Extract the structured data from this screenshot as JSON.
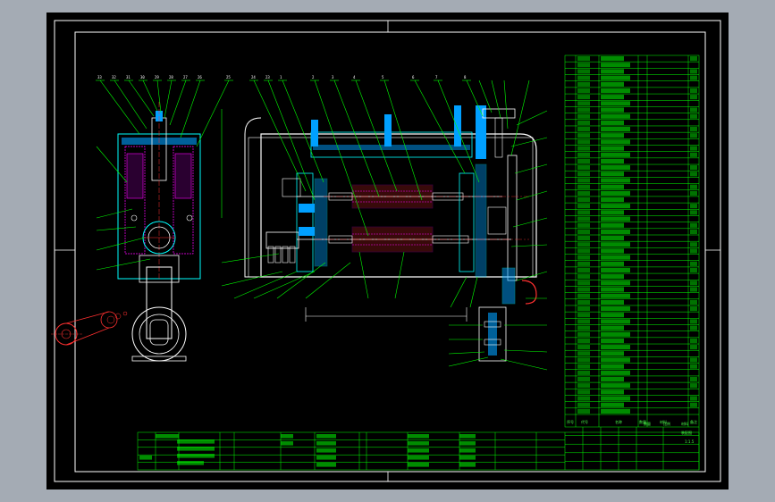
{
  "title_block": {
    "drawing_name": "装配图",
    "scale_label": "比例",
    "scale_value": "1:1.5",
    "quantity_label": "数量",
    "material_label": "材料",
    "bom_headers": [
      "序号",
      "代号",
      "名称",
      "数量",
      "材料",
      "备注"
    ]
  },
  "colors": {
    "sheet": "#000000",
    "frame": "#ffffff",
    "leader": "#00ff00",
    "part_outline": "#00ffff",
    "hidden_line": "#ff00ff",
    "section_fill": "#00a0ff",
    "motor": "#ff3030",
    "text": "#ffffff"
  },
  "callouts_top": [
    "33",
    "32",
    "31",
    "30",
    "29",
    "28",
    "27",
    "26",
    "25",
    "24",
    "23",
    "1",
    "2",
    "3",
    "4",
    "5",
    "6",
    "7",
    "8"
  ]
}
